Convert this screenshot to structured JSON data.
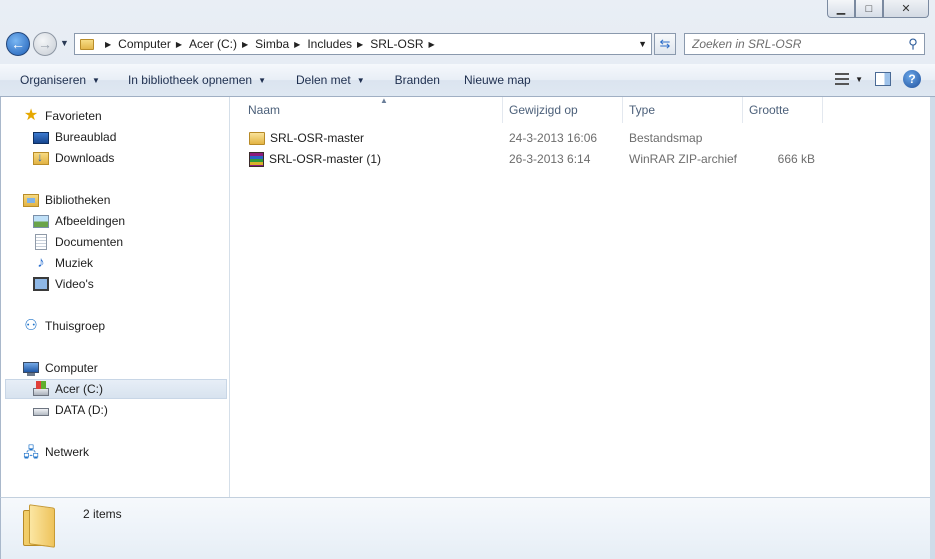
{
  "window": {
    "buttons": {
      "minimize": "▁",
      "maximize": "□",
      "close": "✕"
    }
  },
  "address_bar": {
    "crumbs": [
      "Computer",
      "Acer (C:)",
      "Simba",
      "Includes",
      "SRL-OSR"
    ]
  },
  "search": {
    "placeholder": "Zoeken in SRL-OSR"
  },
  "toolbar": {
    "organize": "Organiseren",
    "include_library": "In bibliotheek opnemen",
    "share_with": "Delen met",
    "burn": "Branden",
    "new_folder": "Nieuwe map",
    "help": "?"
  },
  "sidebar": {
    "favorites": "Favorieten",
    "desktop": "Bureaublad",
    "downloads": "Downloads",
    "libraries": "Bibliotheken",
    "pictures": "Afbeeldingen",
    "documents": "Documenten",
    "music": "Muziek",
    "videos": "Video's",
    "homegroup": "Thuisgroep",
    "computer": "Computer",
    "drive_c": "Acer (C:)",
    "drive_d": "DATA (D:)",
    "network": "Netwerk"
  },
  "columns": {
    "name": "Naam",
    "modified": "Gewijzigd op",
    "type": "Type",
    "size": "Grootte"
  },
  "files": [
    {
      "name": "SRL-OSR-master",
      "modified": "24-3-2013 16:06",
      "type": "Bestandsmap",
      "size": ""
    },
    {
      "name": "SRL-OSR-master (1)",
      "modified": "26-3-2013 6:14",
      "type": "WinRAR ZIP-archief",
      "size": "666 kB"
    }
  ],
  "details": {
    "count": "2 items"
  }
}
